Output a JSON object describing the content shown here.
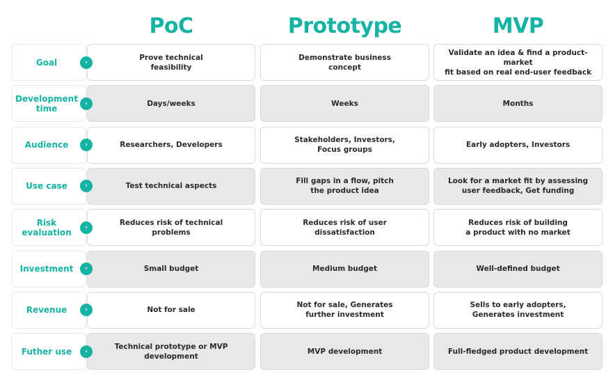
{
  "accent_color": "#14b3a4",
  "columns": [
    "PoC",
    "Prototype",
    "MVP"
  ],
  "badge_icon": "chevron-right-icon",
  "rows": [
    {
      "label": "Goal",
      "cells": [
        "Prove technical\nfeasibility",
        "Demonstrate business\nconcept",
        "Validate an idea & find a product-market\nfit based on real end-user feedback"
      ]
    },
    {
      "label": "Development time",
      "cells": [
        "Days/weeks",
        "Weeks",
        "Months"
      ]
    },
    {
      "label": "Audience",
      "cells": [
        "Researchers, Developers",
        "Stakeholders, Investors,\nFocus groups",
        "Early adopters, Investors"
      ]
    },
    {
      "label": "Use case",
      "cells": [
        "Test technical aspects",
        "Fill gaps in a flow, pitch\nthe product idea",
        "Look for a market fit by assessing\nuser feedback, Get funding"
      ]
    },
    {
      "label": "Risk evaluation",
      "cells": [
        "Reduces risk of technical\nproblems",
        "Reduces risk of user\ndissatisfaction",
        "Reduces risk  of building\na product with no market"
      ]
    },
    {
      "label": "Investment",
      "cells": [
        "Small  budget",
        "Medium budget",
        "Well-defined budget"
      ]
    },
    {
      "label": "Revenue",
      "cells": [
        "Not for sale",
        "Not for sale, Generates\nfurther investment",
        "Sells to early adopters,\nGenerates investment"
      ]
    },
    {
      "label": "Futher use",
      "cells": [
        "Technical prototype or MVP\ndevelopment",
        "MVP development",
        "Full-fledged product development"
      ]
    }
  ]
}
